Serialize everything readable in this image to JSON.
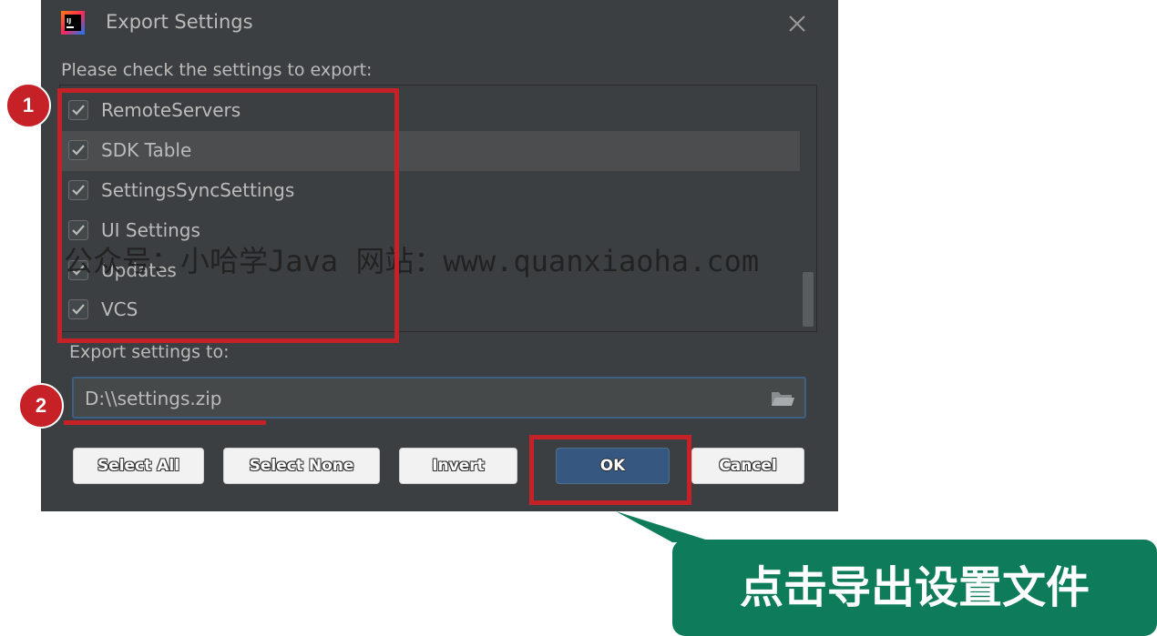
{
  "dialog": {
    "title": "Export Settings",
    "prompt": "Please check the settings to export:",
    "items": [
      {
        "label": "RemoteServers",
        "checked": true,
        "selected": false
      },
      {
        "label": "SDK Table",
        "checked": true,
        "selected": true
      },
      {
        "label": "SettingsSyncSettings",
        "checked": true,
        "selected": false
      },
      {
        "label": "UI Settings",
        "checked": true,
        "selected": false
      },
      {
        "label": "Updates",
        "checked": true,
        "selected": false
      },
      {
        "label": "VCS",
        "checked": true,
        "selected": false
      }
    ],
    "export_label": "Export settings to:",
    "export_path": "D:\\\\settings.zip",
    "buttons": {
      "select_all": "Select All",
      "select_none": "Select None",
      "invert": "Invert",
      "ok": "OK",
      "cancel": "Cancel"
    }
  },
  "annotations": {
    "marker_1": "1",
    "marker_2": "2",
    "callout_text": "点击导出设置文件",
    "accent_color": "#c62127",
    "callout_color": "#0e7c5a"
  },
  "watermark": "公众号：小哈学Java 网站：www.quanxiaoha.com",
  "colors": {
    "dialog_bg": "#3c3f41",
    "text": "#bbbbbb",
    "ok_button": "#365880",
    "field_border": "#3d6185"
  }
}
